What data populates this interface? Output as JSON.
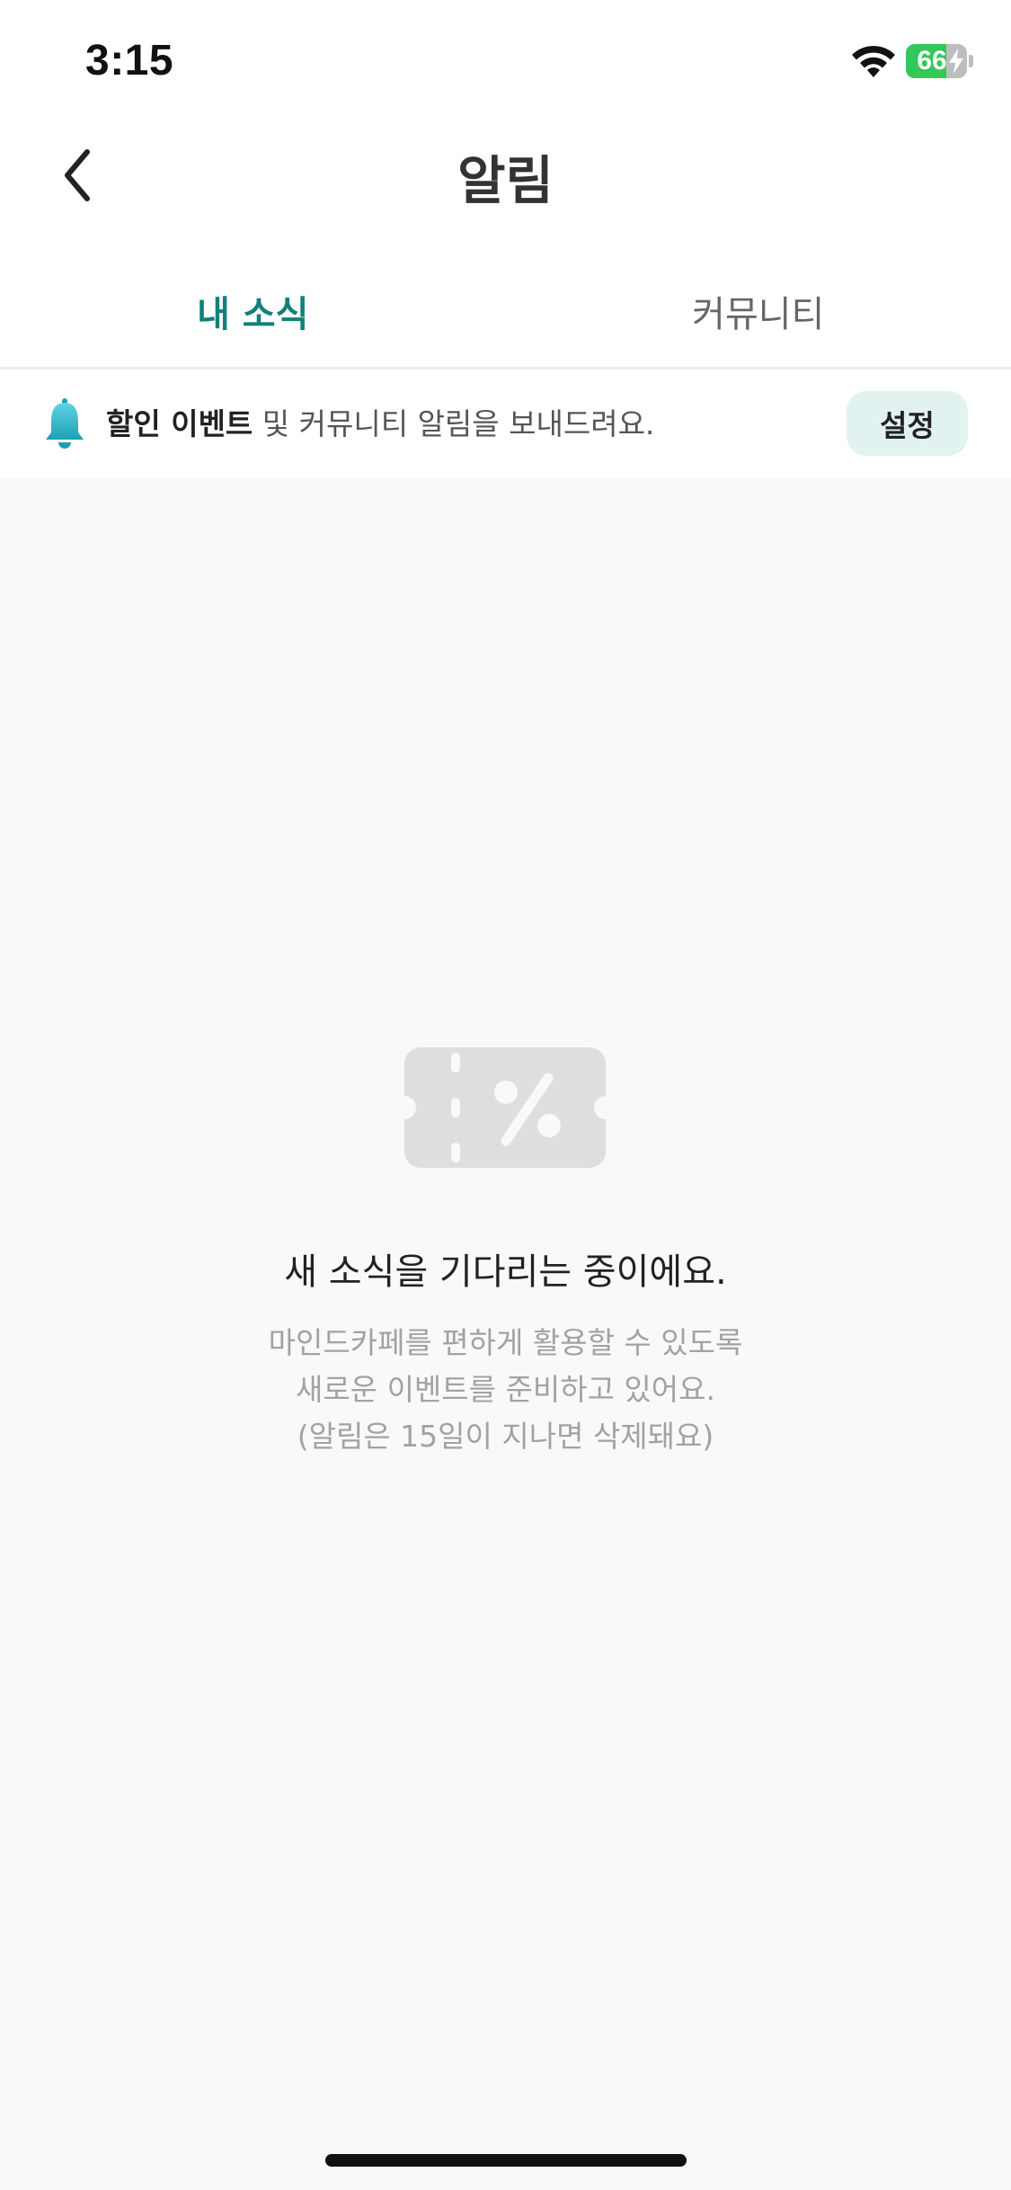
{
  "status_bar": {
    "time": "3:15",
    "battery_level": "66",
    "battery_fraction": 0.66,
    "battery_color": "#34c759",
    "icons": [
      "wifi-icon",
      "battery-charging-icon"
    ]
  },
  "header": {
    "title": "알림",
    "back_icon": "chevron-left-icon"
  },
  "tabs": [
    {
      "label": "내 소식",
      "active": true
    },
    {
      "label": "커뮤니티",
      "active": false
    }
  ],
  "notice": {
    "icon": "bell-icon",
    "strong_text": "할인 이벤트",
    "text": " 및 커뮤니티 알림을 보내드려요.",
    "button_label": "설정"
  },
  "empty_state": {
    "icon": "coupon-percent-icon",
    "title": "새 소식을 기다리는 중이에요.",
    "lines": [
      "마인드카페를 편하게 활용할 수 있도록",
      "새로운 이벤트를 준비하고 있어요.",
      "(알림은 15일이 지나면 삭제돼요)"
    ]
  },
  "colors": {
    "accent": "#13807a",
    "button_bg": "#e1f2f1",
    "bell_gradient_top": "#5fd3e3",
    "bell_gradient_bottom": "#1da0b5",
    "empty_icon": "#dedede"
  }
}
